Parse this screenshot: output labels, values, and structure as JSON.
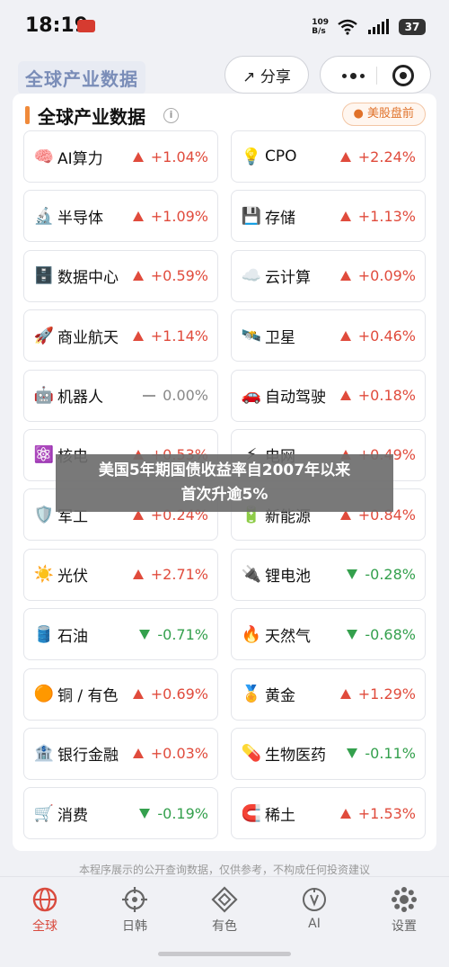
{
  "status_bar": {
    "time": "18:19",
    "net_speed_value": "109",
    "net_speed_unit": "B/s",
    "battery": "37"
  },
  "header": {
    "logo_text": "全球产业数据",
    "share_label": "↗ 分享"
  },
  "section": {
    "title": "全球产业数据",
    "info_icon": "i",
    "us_market_label": "● 美股盘前"
  },
  "tiles": [
    {
      "icon": "🧠",
      "name": "AI算力",
      "change": "+1.04%",
      "dir": "up"
    },
    {
      "icon": "💡",
      "name": "CPO",
      "change": "+2.24%",
      "dir": "up"
    },
    {
      "icon": "🔬",
      "name": "半导体",
      "change": "+1.09%",
      "dir": "up"
    },
    {
      "icon": "💾",
      "name": "存储",
      "change": "+1.13%",
      "dir": "up"
    },
    {
      "icon": "🗄️",
      "name": "数据中心",
      "change": "+0.59%",
      "dir": "up"
    },
    {
      "icon": "☁️",
      "name": "云计算",
      "change": "+0.09%",
      "dir": "up"
    },
    {
      "icon": "🚀",
      "name": "商业航天",
      "change": "+1.14%",
      "dir": "up"
    },
    {
      "icon": "🛰️",
      "name": "卫星",
      "change": "+0.46%",
      "dir": "up"
    },
    {
      "icon": "🤖",
      "name": "机器人",
      "change": "0.00%",
      "dir": "flat"
    },
    {
      "icon": "🚗",
      "name": "自动驾驶",
      "change": "+0.18%",
      "dir": "up"
    },
    {
      "icon": "⚛️",
      "name": "核电",
      "change": "+0.53%",
      "dir": "up"
    },
    {
      "icon": "⚡",
      "name": "电网",
      "change": "+0.49%",
      "dir": "up"
    },
    {
      "icon": "🛡️",
      "name": "军工",
      "change": "+0.24%",
      "dir": "up"
    },
    {
      "icon": "🔋",
      "name": "新能源",
      "change": "+0.84%",
      "dir": "up"
    },
    {
      "icon": "☀️",
      "name": "光伏",
      "change": "+2.71%",
      "dir": "up"
    },
    {
      "icon": "🔌",
      "name": "锂电池",
      "change": "-0.28%",
      "dir": "down"
    },
    {
      "icon": "🛢️",
      "name": "石油",
      "change": "-0.71%",
      "dir": "down"
    },
    {
      "icon": "🔥",
      "name": "天然气",
      "change": "-0.68%",
      "dir": "down"
    },
    {
      "icon": "🟠",
      "name": "铜 / 有色",
      "change": "+0.69%",
      "dir": "up"
    },
    {
      "icon": "🏅",
      "name": "黄金",
      "change": "+1.29%",
      "dir": "up"
    },
    {
      "icon": "🏦",
      "name": "银行金融",
      "change": "+0.03%",
      "dir": "up"
    },
    {
      "icon": "💊",
      "name": "生物医药",
      "change": "-0.11%",
      "dir": "down"
    },
    {
      "icon": "🛒",
      "name": "消费",
      "change": "-0.19%",
      "dir": "down"
    },
    {
      "icon": "🧲",
      "name": "稀土",
      "change": "+1.53%",
      "dir": "up"
    }
  ],
  "news_overlay": {
    "line1": "美国5年期国债收益率自2007年以来",
    "line2": "首次升逾5%"
  },
  "disclaimer": "本程序展示的公开查询数据，仅供参考，不构成任何投资建议",
  "bottom_nav": [
    {
      "label": "全球",
      "icon": "globe-icon",
      "active": true
    },
    {
      "label": "日韩",
      "icon": "crosshair-icon",
      "active": false
    },
    {
      "label": "有色",
      "icon": "diamond-icon",
      "active": false
    },
    {
      "label": "AI",
      "icon": "ai-bulb-icon",
      "active": false
    },
    {
      "label": "设置",
      "icon": "gear-icon",
      "active": false
    }
  ],
  "colors": {
    "up": "#e04b3c",
    "down": "#34a04d",
    "flat": "#888888",
    "accent": "#f08a3a",
    "active_nav": "#d94b3e"
  }
}
